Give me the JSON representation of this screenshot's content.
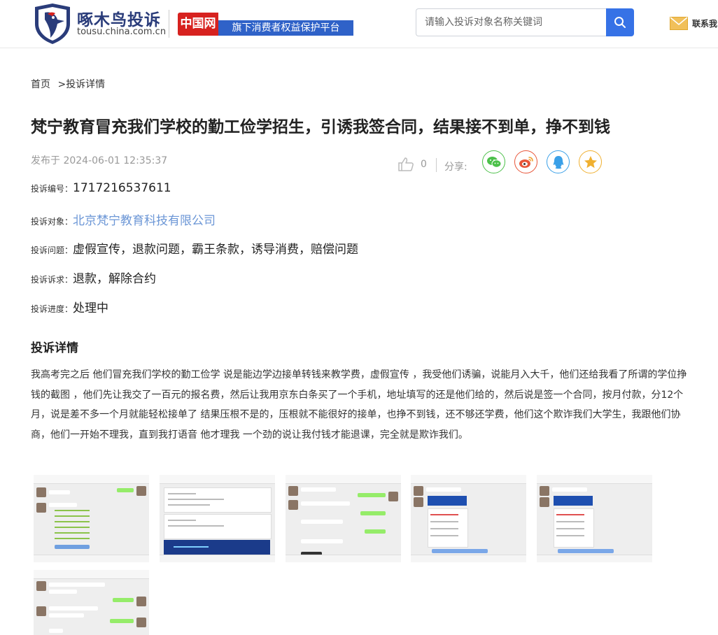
{
  "header": {
    "logo_title": "啄木鸟投诉",
    "logo_domain": "tousu.china.com.cn",
    "china_badge": "中国网",
    "platform_text": "旗下消费者权益保护平台",
    "search_placeholder": "请输入投诉对象名称关键词",
    "contact_label": "联系我"
  },
  "breadcrumb": {
    "home": "首页",
    "separator": ">",
    "current": "投诉详情"
  },
  "complaint": {
    "title": "梵宁教育冒充我们学校的勤工俭学招生，引诱我签合同，结果接不到单，挣不到钱",
    "published": "发布于 2024-06-01 12:35:37",
    "like_count": "0",
    "share_label": "分享:",
    "share_icons": [
      "wechat-icon",
      "weibo-icon",
      "qq-icon",
      "favorite-star-icon"
    ],
    "share_colors": [
      "#4cc04a",
      "#e8563a",
      "#3aa0e8",
      "#f0b030"
    ],
    "fields": [
      {
        "label": "投诉编号：",
        "value": "1717216537611"
      },
      {
        "label": "投诉对象：",
        "value": "北京梵宁教育科技有限公司"
      },
      {
        "label": "投诉问题：",
        "value": "虚假宣传，退款问题，霸王条款，诱导消费，赔偿问题"
      },
      {
        "label": "投诉诉求：",
        "value": "退款，解除合约"
      },
      {
        "label": "投诉进度：",
        "value": "处理中"
      }
    ],
    "detail_heading": "投诉详情",
    "detail_text": "我高考完之后 他们冒充我们学校的勤工俭学 说是能边学边接单转钱来教学费，虚假宣传 ，我受他们诱骗，说能月入大千，他们还给我看了所谓的学位挣钱的截图 ，他们先让我交了一百元的报名费，然后让我用京东白条买了一个手机，地址填写的还是他们给的，然后说是签一个合同，按月付款，分12个月，说是差不多一个月就能轻松接单了 结果压根不是的，压根就不能很好的接单，也挣不到钱，还不够还学费，他们这个欺诈我们大学生，我跟他们协商，他们一开始不理我，直到我打语音 他才理我 一个劲的说让我付钱才能退课，完全就是欺诈我们。",
    "attachments": [
      {
        "name": "attachment-1",
        "kind": "chat"
      },
      {
        "name": "attachment-2",
        "kind": "cards"
      },
      {
        "name": "attachment-3",
        "kind": "chat"
      },
      {
        "name": "attachment-4",
        "kind": "promo"
      },
      {
        "name": "attachment-5",
        "kind": "promo"
      },
      {
        "name": "attachment-6",
        "kind": "chat"
      }
    ]
  },
  "colors": {
    "brand_blue": "#2a3c7a",
    "search_button": "#3672e6",
    "link": "#6b96d6",
    "china_red": "#d7221f",
    "platform_blue": "#2f62c8"
  }
}
